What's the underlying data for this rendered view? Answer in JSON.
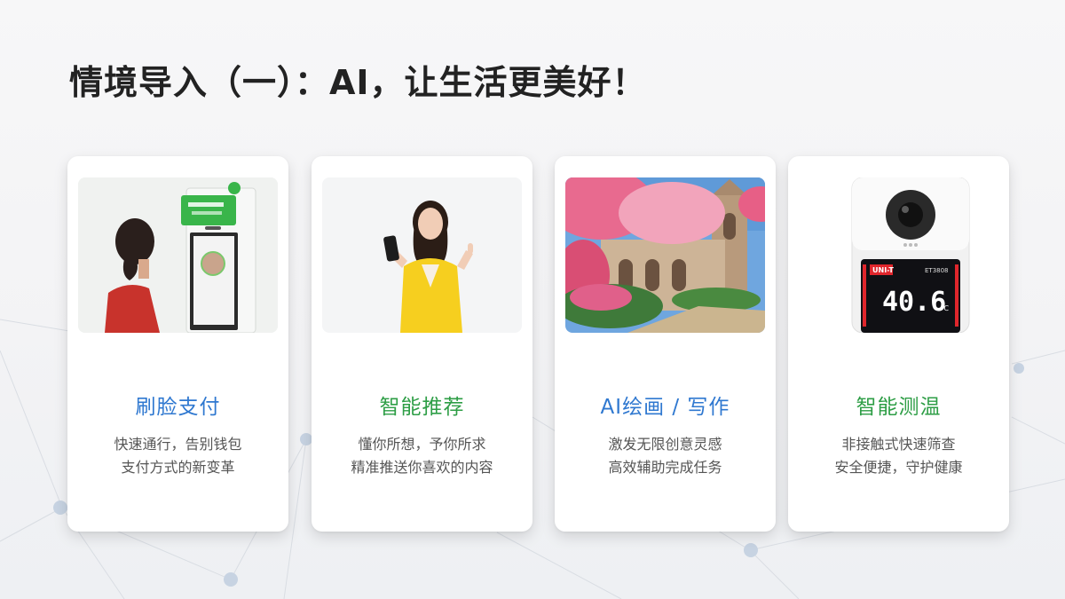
{
  "title": "情境导入（一）：AI，让生活更美好！",
  "colors": {
    "blue": "#2f78d0",
    "green": "#2e9e46",
    "text": "#222222",
    "desc": "#555555"
  },
  "cards": [
    {
      "title": "刷脸支付",
      "title_color": "#2f78d0",
      "desc": [
        "快速通行，告别钱包",
        "支付方式的新变革"
      ],
      "image": "face-pay-terminal-photo"
    },
    {
      "title": "智能推荐",
      "title_color": "#2e9e46",
      "desc": [
        "懂你所想，予你所求",
        "精准推送你喜欢的内容"
      ],
      "image": "woman-holding-phone-photo"
    },
    {
      "title": "AI绘画 / 写作",
      "title_color": "#2f78d0",
      "desc": [
        "激发无限创意灵感",
        "高效辅助完成任务"
      ],
      "image": "ai-painting-cathedral-blossoms"
    },
    {
      "title": "智能测温",
      "title_color": "#2e9e46",
      "desc": [
        "非接触式快速筛查",
        "安全便捷，守护健康"
      ],
      "image": "thermometer-device-photo",
      "device": {
        "brand": "UNI-T",
        "model": "ET3808",
        "reading": "40.6",
        "unit": "℃"
      }
    }
  ]
}
